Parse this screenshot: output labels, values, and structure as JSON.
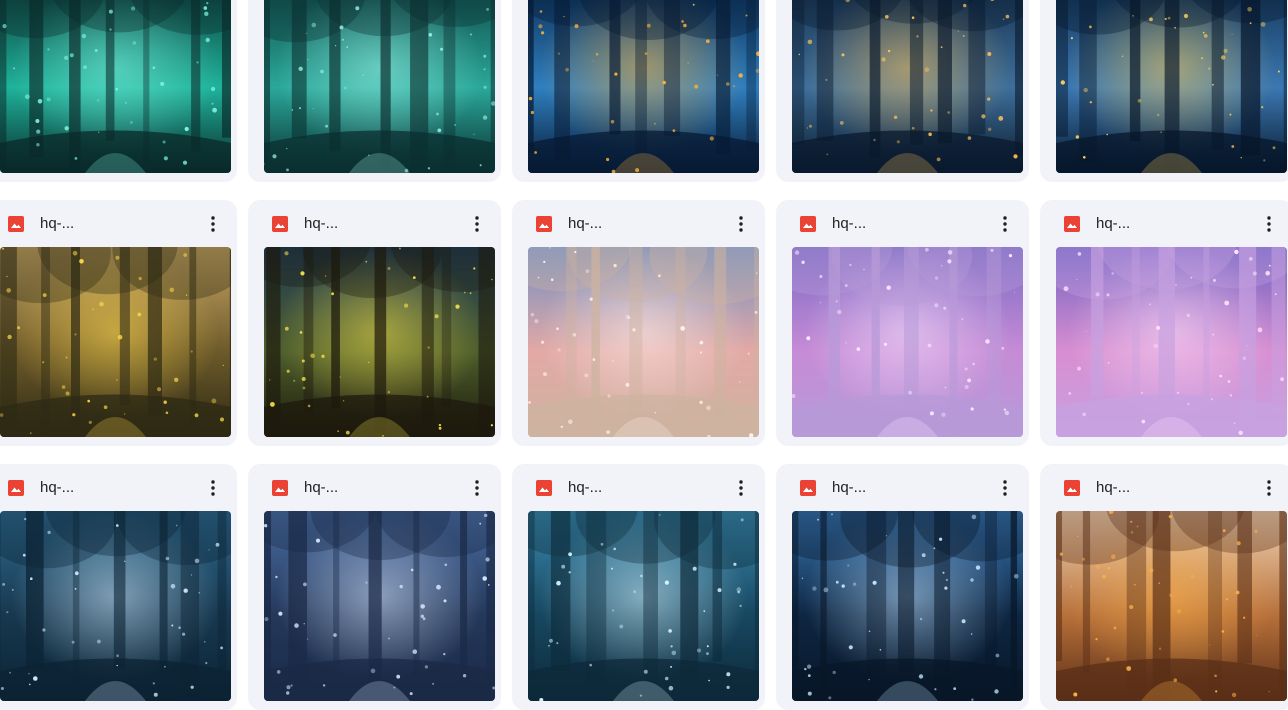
{
  "grid": {
    "rows": [
      {
        "items": [
          {
            "name": "",
            "thumb": "teal-stone-circle-forest",
            "sky": "#0d3b3a",
            "mid": "#1fb39b",
            "ground": "#0a2a2a",
            "accent": "#7ff5e1"
          },
          {
            "name": "",
            "thumb": "teal-misty-stones-forest",
            "sky": "#0f4a48",
            "mid": "#2aa89a",
            "ground": "#0b2f30",
            "accent": "#9ef7ea"
          },
          {
            "name": "",
            "thumb": "blue-lake-fireflies",
            "sky": "#0c2f55",
            "mid": "#2f7fc0",
            "ground": "#071a33",
            "accent": "#ffb43a"
          },
          {
            "name": "",
            "thumb": "blue-foggy-river",
            "sky": "#17324f",
            "mid": "#3e6f9a",
            "ground": "#0a1a2d",
            "accent": "#ffc25a"
          },
          {
            "name": "",
            "thumb": "blue-river-fireflies",
            "sky": "#133456",
            "mid": "#3b78b2",
            "ground": "#07172b",
            "accent": "#ffd15a"
          }
        ]
      },
      {
        "items": [
          {
            "name": "hq-...",
            "thumb": "golden-forest-fireflies",
            "sky": "#c9a766",
            "mid": "#6d5a2a",
            "ground": "#2e2a14",
            "accent": "#ffd84a"
          },
          {
            "name": "hq-...",
            "thumb": "mossy-tree-arch-fireflies",
            "sky": "#1f3b55",
            "mid": "#4d5e2c",
            "ground": "#1d1a0d",
            "accent": "#f5e04a"
          },
          {
            "name": "hq-...",
            "thumb": "pink-blossom-path",
            "sky": "#6f8fc4",
            "mid": "#e3a9a5",
            "ground": "#cdb3a0",
            "accent": "#fff1ec"
          },
          {
            "name": "hq-...",
            "thumb": "lavender-blossom-path",
            "sky": "#7b6bc4",
            "mid": "#c68bd6",
            "ground": "#b79ad8",
            "accent": "#fbe6ff"
          },
          {
            "name": "hq-...",
            "thumb": "pink-purple-blossom-path",
            "sky": "#6f62c2",
            "mid": "#d88ed1",
            "ground": "#c7a1e0",
            "accent": "#ffe4fb"
          }
        ]
      },
      {
        "items": [
          {
            "name": "hq-...",
            "thumb": "blue-tree-tunnel",
            "sky": "#2f6a8e",
            "mid": "#17384f",
            "ground": "#0c2334",
            "accent": "#cfeaff"
          },
          {
            "name": "hq-...",
            "thumb": "periwinkle-tree-tunnel",
            "sky": "#4a6ea2",
            "mid": "#24385b",
            "ground": "#1a2946",
            "accent": "#d9e7ff"
          },
          {
            "name": "hq-...",
            "thumb": "aqua-tree-tunnel",
            "sky": "#3a8bb0",
            "mid": "#174760",
            "ground": "#0d2a3a",
            "accent": "#d6f4ff"
          },
          {
            "name": "hq-...",
            "thumb": "night-tree-arch",
            "sky": "#3a78b5",
            "mid": "#0e2642",
            "ground": "#081728",
            "accent": "#bfe2ff"
          },
          {
            "name": "hq-...",
            "thumb": "mushroom-village-lanterns",
            "sky": "#f0d6b8",
            "mid": "#b7703a",
            "ground": "#5a2f17",
            "accent": "#ffb347"
          }
        ]
      }
    ]
  }
}
